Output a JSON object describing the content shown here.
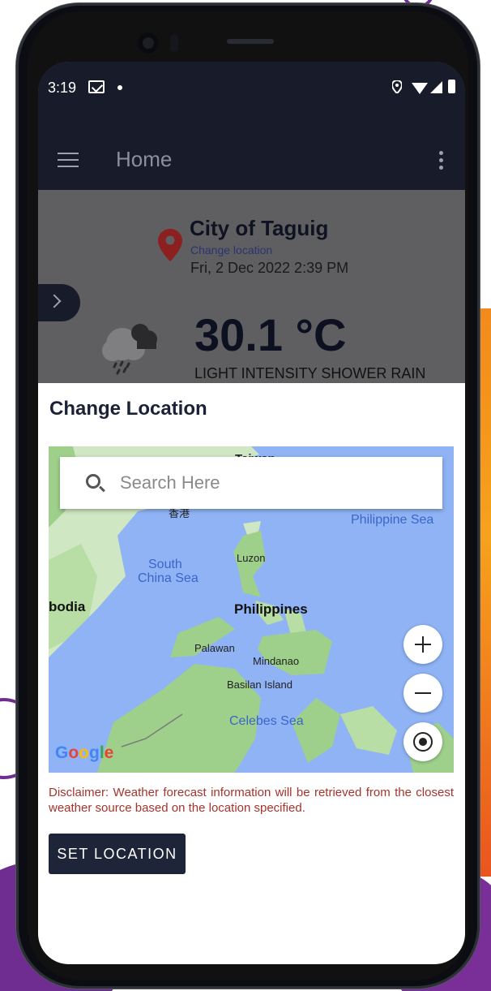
{
  "status_bar": {
    "time": "3:19"
  },
  "app_bar": {
    "title": "Home"
  },
  "weather": {
    "city": "City of Taguig",
    "change_location_link": "Change location",
    "datetime": "Fri, 2 Dec 2022 2:39 PM",
    "temperature": "30.1 °C",
    "description": "LIGHT INTENSITY SHOWER RAIN"
  },
  "sheet": {
    "title": "Change Location",
    "search_placeholder": "Search Here",
    "map_labels": {
      "taiwan": "Taiwan",
      "hong_kong": "香港",
      "philippine_sea": "Philippine Sea",
      "luzon": "Luzon",
      "south_china_sea_1": "South",
      "south_china_sea_2": "China Sea",
      "cambodia": "bodia",
      "philippines": "Philippines",
      "palawan": "Palawan",
      "mindanao": "Mindanao",
      "basilan": "Basilan Island",
      "celebes_sea": "Celebes Sea"
    },
    "google_logo": "Google",
    "disclaimer": "Disclaimer: Weather forecast information will be retrieved from the closest weather source based on the location specified.",
    "set_location_label": "SET LOCATION"
  },
  "colors": {
    "app_bar": "#181c2a",
    "accent_button": "#1f2538",
    "disclaimer_text": "#a6342b",
    "map_water": "#8fb3f5",
    "map_land": "#cfe7c2"
  },
  "icons": [
    "gmail-icon",
    "location-icon",
    "wifi-icon",
    "signal-icon",
    "battery-icon",
    "menu-icon",
    "more-vert-icon",
    "map-pin-icon",
    "chevron-right-icon",
    "rain-cloud-icon",
    "search-icon",
    "zoom-in-icon",
    "zoom-out-icon",
    "my-location-icon"
  ]
}
